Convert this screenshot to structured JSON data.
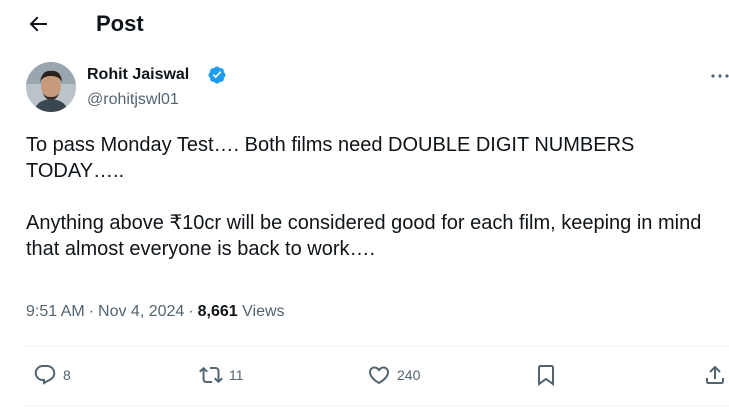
{
  "header": {
    "title": "Post"
  },
  "author": {
    "name": "Rohit Jaiswal",
    "handle": "@rohitjswl01",
    "verified": true,
    "verified_color": "#1d9bf0"
  },
  "tweet": {
    "paragraphs": [
      "To pass Monday Test…. Both films need DOUBLE DIGIT NUMBERS TODAY…..",
      "Anything above ₹10cr will be considered good for each film, keeping in mind that almost everyone is back to work…."
    ]
  },
  "meta": {
    "time": "9:51 AM",
    "separator": "·",
    "date": "Nov 4, 2024",
    "views_count": "8,661",
    "views_label": "Views"
  },
  "actions": {
    "reply_count": "8",
    "retweet_count": "11",
    "like_count": "240",
    "icons": [
      "reply-icon",
      "retweet-icon",
      "heart-icon",
      "bookmark-icon",
      "share-icon"
    ]
  },
  "colors": {
    "text": "#0f1419",
    "secondary": "#536471",
    "accent": "#1d9bf0",
    "divider": "#eff3f4"
  }
}
